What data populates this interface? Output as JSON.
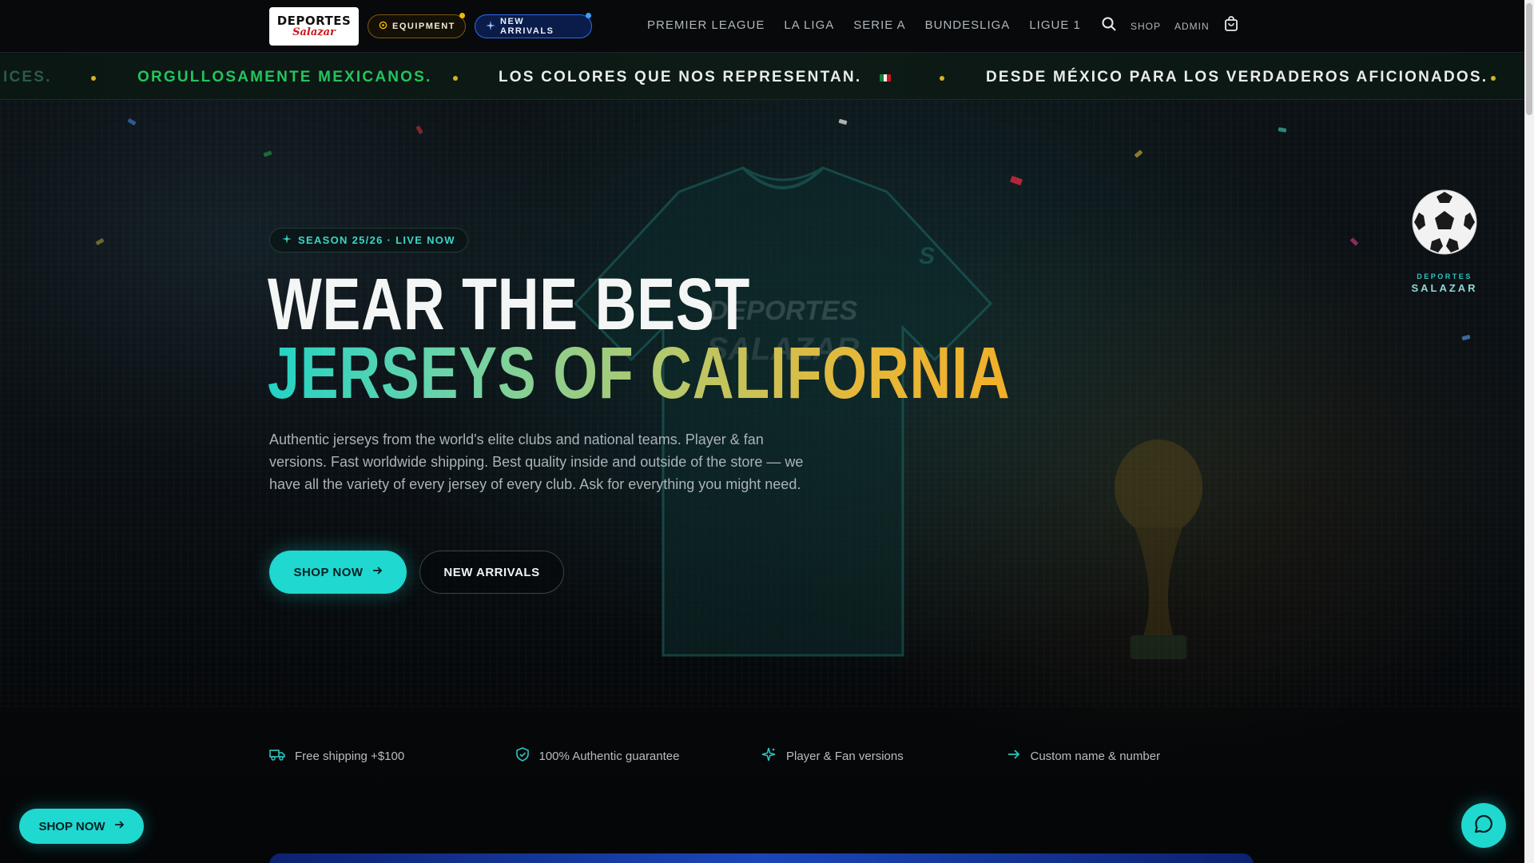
{
  "header": {
    "logo": {
      "line1": "DEPORTES",
      "line2": "Salazar"
    },
    "pills": [
      {
        "label": "EQUIPMENT",
        "dot_color": "#f2b705",
        "icon": "gear-icon"
      },
      {
        "label": "NEW ARRIVALS",
        "dot_color": "#3aa0ff",
        "icon": "sparkle-icon"
      }
    ],
    "nav": [
      "PREMIER LEAGUE",
      "LA LIGA",
      "SERIE A",
      "BUNDESLIGA",
      "LIGUE 1"
    ],
    "shop_label": "SHOP",
    "admin_label": "ADMIN"
  },
  "marquee": {
    "items": [
      {
        "text": "ICES.",
        "color": "#2c5a4a"
      },
      {
        "text": "ORGULLOSAMENTE MEXICANOS.",
        "color": "#22c55e"
      },
      {
        "text": "LOS COLORES QUE NOS REPRESENTAN.",
        "color": "#e9ecec"
      },
      {
        "text": "DESDE MÉXICO PARA LOS VERDADEROS AFICIONADOS.",
        "color": "#e9ecec"
      }
    ],
    "flag_icon": "mexico-flag-icon"
  },
  "hero": {
    "badge": "SEASON 25/26 · LIVE NOW",
    "title_line1": "WEAR THE BEST",
    "title_line2": "JERSEYS OF CALIFORNIA",
    "description": "Authentic jerseys from the world's elite clubs and national teams. Player & fan versions. Fast worldwide shipping. Best quality inside and outside of the store — we have all the variety of every jersey of every club. Ask for everything you might need.",
    "primary_cta": "SHOP NOW",
    "secondary_cta": "NEW ARRIVALS"
  },
  "features": [
    {
      "label": "Free shipping +$100",
      "icon": "truck-icon"
    },
    {
      "label": "100% Authentic guarantee",
      "icon": "shield-check-icon"
    },
    {
      "label": "Player & Fan versions",
      "icon": "sparkle-icon"
    },
    {
      "label": "Custom name & number",
      "icon": "arrow-right-icon"
    }
  ],
  "side_brand": {
    "top": "DEPORTES",
    "bottom": "SALAZAR"
  },
  "floating": {
    "shop_label": "SHOP NOW"
  },
  "colors": {
    "accent": "#1fd8d0",
    "gold": "#f0b02a",
    "green": "#22c55e"
  }
}
